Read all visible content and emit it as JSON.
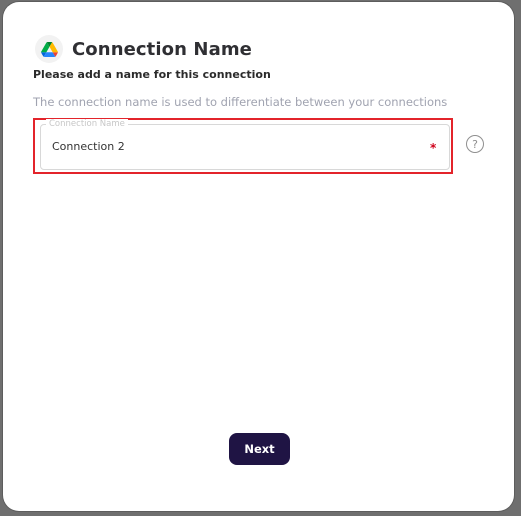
{
  "dialog": {
    "title": "Connection Name",
    "subtitle": "Please add a name for this connection",
    "helper_text": "The connection name is used to differentiate between your connections",
    "logo_icon": "google-drive-icon"
  },
  "field": {
    "label": "Connection Name",
    "value": "Connection 2",
    "required_marker": "*",
    "help_icon": "help-circle-icon",
    "help_glyph": "?"
  },
  "actions": {
    "next_label": "Next"
  },
  "colors": {
    "accent": "#1f1444",
    "highlight": "#e3242b",
    "required": "#d0021b"
  }
}
